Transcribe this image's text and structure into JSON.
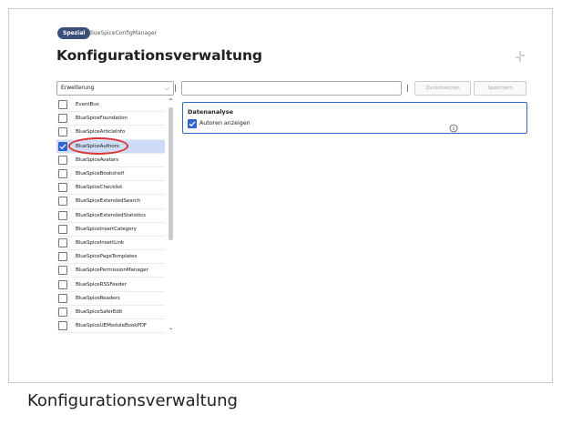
{
  "header": {
    "badge": "Spezial",
    "breadcrumb": "BlueSpiceConfigManager",
    "title": "Konfigurationsverwaltung"
  },
  "toolbar": {
    "filter_value": "Erweiterung",
    "search_value": "",
    "reset_label": "Zurücksetzen",
    "save_label": "Speichern"
  },
  "extensions": [
    {
      "label": "EventBus",
      "checked": false
    },
    {
      "label": "BlueSpiceFoundation",
      "checked": false
    },
    {
      "label": "BlueSpiceArticleInfo",
      "checked": false
    },
    {
      "label": "BlueSpiceAuthors",
      "checked": true,
      "selected": true
    },
    {
      "label": "BlueSpiceAvatars",
      "checked": false
    },
    {
      "label": "BlueSpiceBookshelf",
      "checked": false
    },
    {
      "label": "BlueSpiceChecklist",
      "checked": false
    },
    {
      "label": "BlueSpiceExtendedSearch",
      "checked": false
    },
    {
      "label": "BlueSpiceExtendedStatistics",
      "checked": false
    },
    {
      "label": "BlueSpiceInsertCategory",
      "checked": false
    },
    {
      "label": "BlueSpiceInsertLink",
      "checked": false
    },
    {
      "label": "BlueSpicePageTemplates",
      "checked": false
    },
    {
      "label": "BlueSpicePermissionManager",
      "checked": false
    },
    {
      "label": "BlueSpiceRSSFeeder",
      "checked": false
    },
    {
      "label": "BlueSpiceReaders",
      "checked": false
    },
    {
      "label": "BlueSpiceSaferEdit",
      "checked": false
    },
    {
      "label": "BlueSpiceUEModuleBookPDF",
      "checked": false
    }
  ],
  "panel": {
    "heading": "Datenanalyse",
    "option_label": "Autoren anzeigen",
    "option_checked": true
  },
  "caption": "Konfigurationsverwaltung",
  "colors": {
    "accent": "#3366cc",
    "selected_row": "#cfdcf5",
    "badge": "#3e4e7a",
    "highlight": "#dd3333"
  }
}
